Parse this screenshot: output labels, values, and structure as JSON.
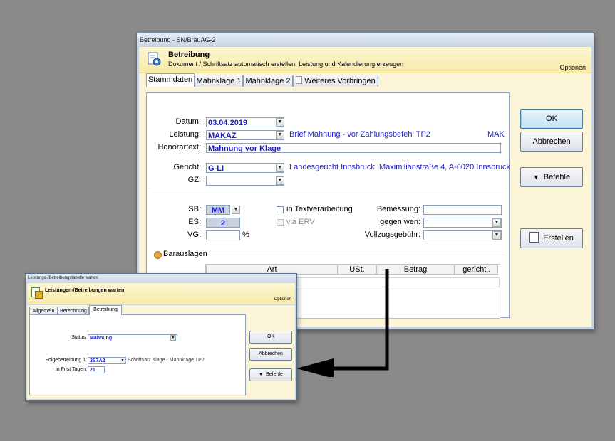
{
  "main_window": {
    "title": "Betreibung - SN/BrauAG-2",
    "header": {
      "title": "Betreibung",
      "subtitle": "Dokument / Schriftsatz automatisch erstellen, Leistung und Kalendierung erzeugen",
      "options": "Optionen"
    },
    "tabs": [
      "Stammdaten",
      "Mahnklage 1",
      "Mahnklage 2",
      "Weiteres Vorbringen"
    ],
    "form": {
      "datum_label": "Datum:",
      "datum_value": "03.04.2019",
      "leistung_label": "Leistung:",
      "leistung_value": "MAKAZ",
      "leistung_desc": "Brief Mahnung - vor Zahlungsbefehl TP2",
      "leistung_code": "MAK",
      "honorartext_label": "Honorartext:",
      "honorartext_value": "Mahnung vor Klage",
      "gericht_label": "Gericht:",
      "gericht_value": "G-LI",
      "gericht_desc": "Landesgericht Innsbruck, Maximilianstraße 4, A-6020 Innsbruck",
      "gz_label": "GZ:",
      "gz_value": "",
      "sb_label": "SB:",
      "sb_value": "MM",
      "es_label": "ES:",
      "es_value": "2",
      "vg_label": "VG:",
      "vg_value": "",
      "vg_unit": "%",
      "textverarbeitung_label": "in Textverarbeitung",
      "erv_label": "via ERV",
      "bemessung_label": "Bemessung:",
      "bemessung_value": "",
      "gegen_wen_label": "gegen wen:",
      "gegen_wen_value": "",
      "vollzug_label": "Vollzugsgebühr:",
      "vollzug_value": "",
      "barauslagen_label": "Barauslagen",
      "grid_headers": [
        "Art",
        "USt.",
        "Betrag",
        "gerichtl."
      ]
    },
    "buttons": {
      "ok": "OK",
      "abbrechen": "Abbrechen",
      "befehle": "Befehle",
      "erstellen": "Erstellen"
    }
  },
  "small_window": {
    "title": "Leistungs-/Betreibungstabelle warten",
    "header": {
      "title": "Leistungen-/Betreibungen warten",
      "options": "Optionen"
    },
    "tabs": [
      "Allgemein",
      "Berechnung",
      "Betreibung"
    ],
    "form": {
      "status_label": "Status:",
      "status_value": "Mahnung",
      "folge_label": "Folgebetreibung 1:",
      "folge_value": "2S7A2",
      "folge_desc": "Schriftsatz Klage - Mahnklage TP2",
      "frist_label": "in Frist Tagen:",
      "frist_value": "21"
    },
    "buttons": {
      "ok": "OK",
      "abbrechen": "Abbrechen",
      "befehle": "Befehle"
    }
  },
  "colors": {
    "background": "#8a8a8a",
    "header_yellow": "#f7e9a8",
    "value_blue": "#1d1ed0",
    "arrow": "#000000"
  }
}
